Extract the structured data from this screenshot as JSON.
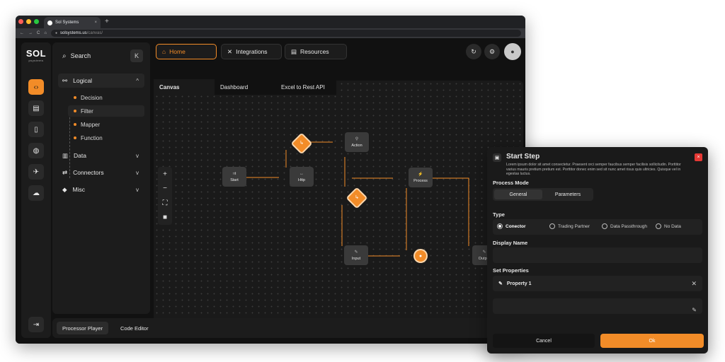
{
  "browser": {
    "tab_title": "Sol Systems",
    "tab_close": "×",
    "new_tab": "+",
    "url_domain": "solsystems.us",
    "url_path": "/canvas/",
    "nav": [
      "←",
      "→",
      "C",
      "⌂"
    ]
  },
  "logo": {
    "main": "SOL",
    "sub": "psystems"
  },
  "rail": [
    {
      "icon": "code-icon",
      "glyph": "‹›"
    },
    {
      "icon": "cards-icon",
      "glyph": "▤"
    },
    {
      "icon": "file-icon",
      "glyph": "▯"
    },
    {
      "icon": "globe-icon",
      "glyph": "◍"
    },
    {
      "icon": "rocket-icon",
      "glyph": "✈"
    },
    {
      "icon": "cloud-icon",
      "glyph": "☁"
    },
    {
      "icon": "expand-icon",
      "glyph": "⇥"
    }
  ],
  "sidebar": {
    "search_label": "Search",
    "collapse_glyph": "K",
    "groups": [
      {
        "label": "Logical",
        "icon": "logic-icon",
        "glyph": "⚯",
        "chevron": "^"
      },
      {
        "label": "Data",
        "icon": "chart-icon",
        "glyph": "▥",
        "chevron": "v"
      },
      {
        "label": "Connectors",
        "icon": "connector-icon",
        "glyph": "⇄",
        "chevron": "v"
      },
      {
        "label": "Misc",
        "icon": "shapes-icon",
        "glyph": "◆",
        "chevron": "v"
      }
    ],
    "logical_items": [
      "Decision",
      "Filter",
      "Mapper",
      "Function"
    ],
    "selected_item": "Filter"
  },
  "topnav": {
    "home": "Home",
    "integrations": "Integrations",
    "resources": "Resources"
  },
  "canvas_tabs": [
    "Canvas",
    "Dashboard",
    "Excel to Rest API"
  ],
  "zoom_tools": [
    "+",
    "−",
    "⛶",
    "■"
  ],
  "nodes": {
    "start": "Start",
    "http": "Http",
    "action": "Action",
    "process": "Process",
    "input": "Input",
    "output": "Output"
  },
  "bottombar": {
    "processor_player": "Processor Player",
    "code_editor": "Code Editor"
  },
  "dialog": {
    "title": "Start Step",
    "description": "Lorem ipsum dolor sit amet consectetur. Praesent orci semper faucibus semper facilisis sollicitudin. Porttitor varius mauris pretium pretium est. Porttitor donec enim sed sit nunc amet risus quis ultricies. Quisque vel in egestas luctus.",
    "close_glyph": "×",
    "process_mode_label": "Process Mode",
    "modes": [
      "General",
      "Parameters"
    ],
    "type_label": "Type",
    "types": [
      "Conector",
      "Trading Partner",
      "Data Passthrough",
      "No Data"
    ],
    "selected_type": "Conector",
    "display_name_label": "Display Name",
    "display_name_value": "",
    "set_properties_label": "Set Properties",
    "property_name": "Property 1",
    "property_value": "",
    "cancel": "Cancel",
    "ok": "Ok"
  },
  "colors": {
    "accent": "#f28c28",
    "danger": "#e53935",
    "panel": "#1c1c1c",
    "background": "#111111"
  }
}
